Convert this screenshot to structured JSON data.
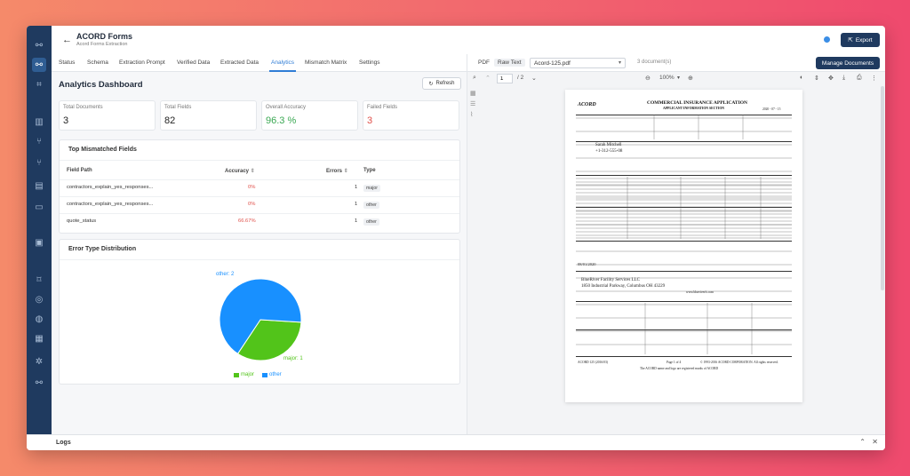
{
  "header": {
    "back_icon": "arrow-left-icon",
    "title": "ACORD Forms",
    "subtitle": "Acord Forms Extraction",
    "export_label": "Export"
  },
  "tabs": [
    {
      "label": "Status"
    },
    {
      "label": "Schema"
    },
    {
      "label": "Extraction Prompt"
    },
    {
      "label": "Verified Data"
    },
    {
      "label": "Extracted Data"
    },
    {
      "label": "Analytics"
    },
    {
      "label": "Mismatch Matrix"
    },
    {
      "label": "Settings"
    }
  ],
  "dashboard": {
    "title": "Analytics Dashboard",
    "refresh_label": "Refresh",
    "stats": [
      {
        "label": "Total Documents",
        "value": "3",
        "color": "#222222"
      },
      {
        "label": "Total Fields",
        "value": "82",
        "color": "#222222"
      },
      {
        "label": "Overall Accuracy",
        "value": "96.3 %",
        "color": "#3aa853"
      },
      {
        "label": "Failed Fields",
        "value": "3",
        "color": "#e0504a"
      }
    ],
    "mismatched": {
      "title": "Top Mismatched Fields",
      "headers": {
        "field": "Field Path",
        "accuracy": "Accuracy",
        "errors": "Errors",
        "type": "Type"
      },
      "rows": [
        {
          "field": "contractors_explain_yes_responses...",
          "accuracy": "0%",
          "errors": "1",
          "type": "major"
        },
        {
          "field": "contractors_explain_yes_responses...",
          "accuracy": "0%",
          "errors": "1",
          "type": "other"
        },
        {
          "field": "quote_status",
          "accuracy": "66.67%",
          "errors": "1",
          "type": "other"
        }
      ]
    },
    "error_dist": {
      "title": "Error Type Distribution"
    }
  },
  "chart_data": {
    "type": "pie",
    "series": [
      {
        "name": "major",
        "value": 1,
        "color": "#52c41a",
        "label": "major: 1"
      },
      {
        "name": "other",
        "value": 2,
        "color": "#1890ff",
        "label": "other: 2"
      }
    ]
  },
  "viewer": {
    "pdf_label": "PDF",
    "raw_label": "Raw Text",
    "file": "Acord-125.pdf",
    "doc_count": "3 document(s)",
    "manage_label": "Manage Documents",
    "page": "1",
    "page_total": "/ 2",
    "zoom": "100%"
  },
  "pdf": {
    "brand": "ACORD",
    "heading": "COMMERCIAL INSURANCE APPLICATION",
    "subheading": "APPLICANT INFORMATION SECTION",
    "date": "2020 - 07 - 15",
    "applicant_name": "Sarah Mitchell",
    "phone": "+1-312-555-08",
    "insured": "BlueRiver Facility Services LLC",
    "address": "1850 Industrial Parkway, Columbus OH 43229",
    "policy_date": "08/01/2020",
    "website": "www.blueriverfs.com",
    "footer_left": "ACORD 125 (2016/03)",
    "footer_page": "Page 1 of 4",
    "footer_copy": "© 1993-2016 ACORD CORPORATION. All rights reserved.",
    "footer_trademark": "The ACORD name and logo are registered marks of ACORD"
  },
  "logs": {
    "label": "Logs"
  }
}
